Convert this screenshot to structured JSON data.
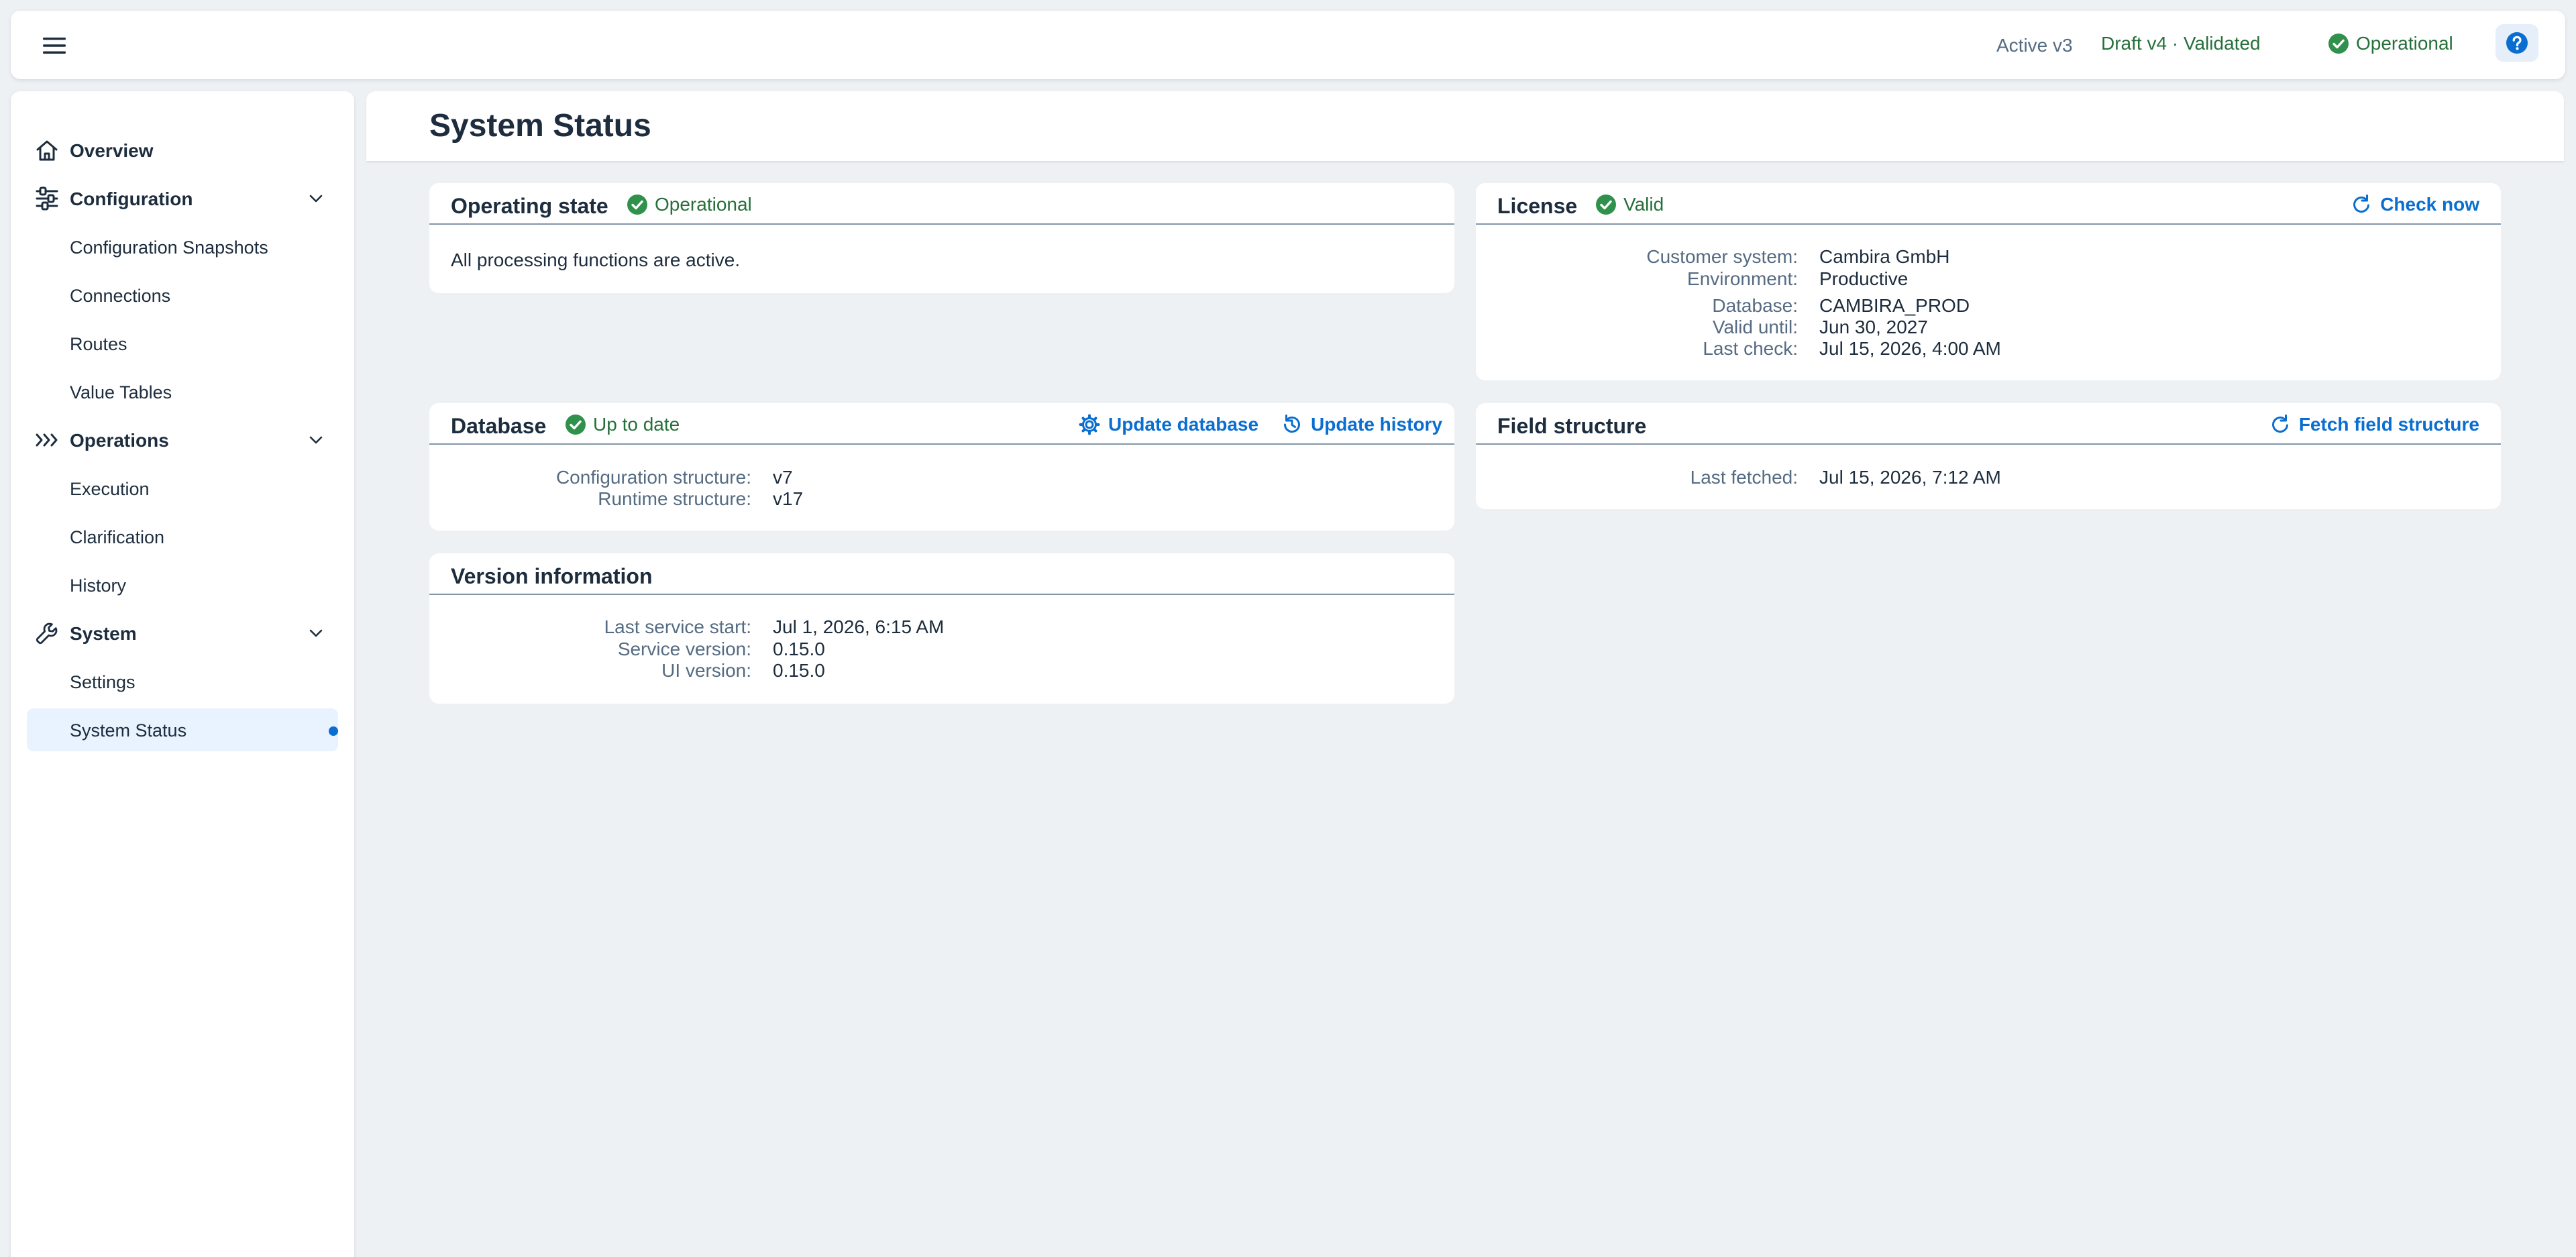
{
  "shell": {
    "active_version": "Active v3",
    "draft_version": "Draft v4 · Validated",
    "status": "Operational"
  },
  "sidebar": {
    "overview": "Overview",
    "configuration": {
      "label": "Configuration",
      "items": [
        "Configuration Snapshots",
        "Connections",
        "Routes",
        "Value Tables"
      ]
    },
    "operations": {
      "label": "Operations",
      "items": [
        "Execution",
        "Clarification",
        "History"
      ]
    },
    "system": {
      "label": "System",
      "items": [
        "Settings",
        "System Status"
      ]
    }
  },
  "page": {
    "title": "System Status"
  },
  "operating_state": {
    "title": "Operating state",
    "status": "Operational",
    "message": "All processing functions are active."
  },
  "license": {
    "title": "License",
    "status": "Valid",
    "action": "Check now",
    "fields": [
      {
        "label": "Customer system:",
        "value": "Cambira GmbH"
      },
      {
        "label": "Environment:",
        "value": "Productive"
      },
      {
        "label": "Database:",
        "value": "CAMBIRA_PROD"
      },
      {
        "label": "Valid until:",
        "value": "Jun 30, 2027"
      },
      {
        "label": "Last check:",
        "value": "Jul 15, 2026, 4:00 AM"
      }
    ]
  },
  "database": {
    "title": "Database",
    "status": "Up to date",
    "update_action": "Update database",
    "history_action": "Update history",
    "fields": [
      {
        "label": "Configuration structure:",
        "value": "v7"
      },
      {
        "label": "Runtime structure:",
        "value": "v17"
      }
    ]
  },
  "field_structure": {
    "title": "Field structure",
    "action": "Fetch field structure",
    "fields": [
      {
        "label": "Last fetched:",
        "value": "Jul 15, 2026, 7:12 AM"
      }
    ]
  },
  "version_info": {
    "title": "Version information",
    "fields": [
      {
        "label": "Last service start:",
        "value": "Jul 1, 2026, 6:15 AM"
      },
      {
        "label": "Service version:",
        "value": "0.15.0"
      },
      {
        "label": "UI version:",
        "value": "0.15.0"
      }
    ]
  },
  "colors": {
    "accent": "#0a6ed1",
    "positive": "#256f3a",
    "positive_icon": "#30914c",
    "text": "#1d2d3e",
    "label": "#556b82",
    "background": "#eef1f4"
  }
}
